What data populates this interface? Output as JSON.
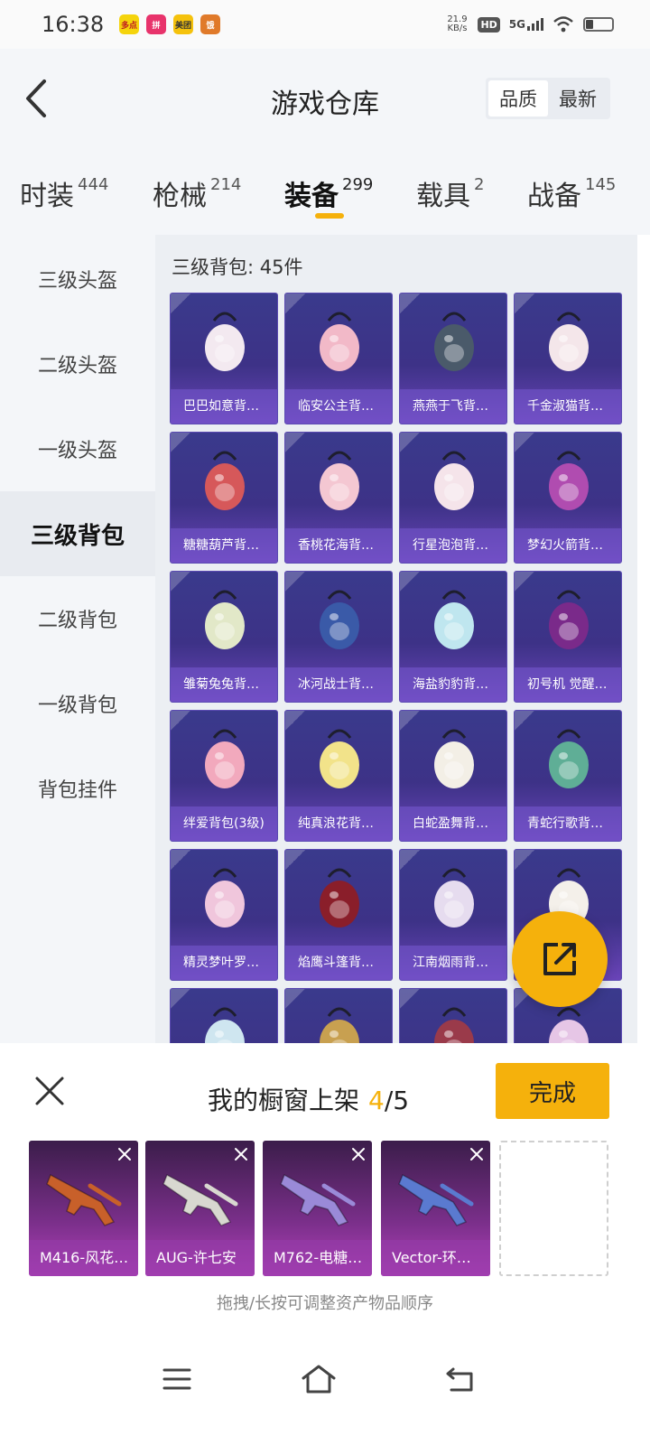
{
  "status_bar": {
    "time": "16:38",
    "notifications": [
      {
        "icon": "app-icon-1",
        "color": "#f5d40c",
        "text": "多点"
      },
      {
        "icon": "app-icon-2",
        "color": "#e8336b",
        "text": "拼"
      },
      {
        "icon": "app-icon-3",
        "color": "#f5c20c",
        "text": "美团"
      },
      {
        "icon": "app-icon-4",
        "color": "#e07a2a",
        "text": "饿"
      }
    ],
    "net_speed_value": "21.9",
    "net_speed_unit": "KB/s",
    "hd": "HD",
    "network": "5G"
  },
  "header": {
    "title": "游戏仓库",
    "sort_options": [
      {
        "label": "品质",
        "active": true
      },
      {
        "label": "最新",
        "active": false
      }
    ]
  },
  "tabs": [
    {
      "label": "时装",
      "count": "444",
      "active": false
    },
    {
      "label": "枪械",
      "count": "214",
      "active": false
    },
    {
      "label": "装备",
      "count": "299",
      "active": true
    },
    {
      "label": "载具",
      "count": "2",
      "active": false
    },
    {
      "label": "战备",
      "count": "145",
      "active": false
    }
  ],
  "sidebar": {
    "items": [
      {
        "label": "三级头盔",
        "active": false
      },
      {
        "label": "二级头盔",
        "active": false
      },
      {
        "label": "一级头盔",
        "active": false
      },
      {
        "label": "三级背包",
        "active": true
      },
      {
        "label": "二级背包",
        "active": false
      },
      {
        "label": "一级背包",
        "active": false
      },
      {
        "label": "背包挂件",
        "active": false
      }
    ]
  },
  "content": {
    "section_title": "三级背包: 45件",
    "items": [
      {
        "label": "巴巴如意背…",
        "color": "#f3e9f0"
      },
      {
        "label": "临安公主背…",
        "color": "#f2b9c8"
      },
      {
        "label": "燕燕于飞背…",
        "color": "#4a5a6a"
      },
      {
        "label": "千金淑猫背…",
        "color": "#f4e6ea"
      },
      {
        "label": "糖糖葫芦背…",
        "color": "#d6585a"
      },
      {
        "label": "香桃花海背…",
        "color": "#f4c7d2"
      },
      {
        "label": "行星泡泡背…",
        "color": "#f5e4ea"
      },
      {
        "label": "梦幻火箭背…",
        "color": "#b04cb0"
      },
      {
        "label": "雏菊兔兔背…",
        "color": "#e2e8c8"
      },
      {
        "label": "冰河战士背…",
        "color": "#3a5aa8"
      },
      {
        "label": "海盐豹豹背…",
        "color": "#bfe6ef"
      },
      {
        "label": "初号机 觉醒…",
        "color": "#7a2a8a"
      },
      {
        "label": "绊爱背包(3级)",
        "color": "#f2a9bd"
      },
      {
        "label": "纯真浪花背…",
        "color": "#f2e38a"
      },
      {
        "label": "白蛇盈舞背…",
        "color": "#f3efe6"
      },
      {
        "label": "青蛇行歌背…",
        "color": "#5fae96"
      },
      {
        "label": "精灵梦叶罗…",
        "color": "#f0c6dc"
      },
      {
        "label": "焰鹰斗篷背…",
        "color": "#8a1e2a"
      },
      {
        "label": "江南烟雨背…",
        "color": "#e6dcef"
      },
      {
        "label": "",
        "color": "#f4f0ea"
      },
      {
        "label": "",
        "color": "#cfe6f0"
      },
      {
        "label": "",
        "color": "#c8a050"
      },
      {
        "label": "",
        "color": "#9a3a4a"
      },
      {
        "label": "",
        "color": "#e6c6e6"
      }
    ]
  },
  "showcase": {
    "title": "我的橱窗上架",
    "count_used": "4",
    "count_sep": "/",
    "count_total": "5",
    "done_label": "完成",
    "slots": [
      {
        "label": "M416-风花…",
        "color": "#c8602a"
      },
      {
        "label": "AUG-许七安",
        "color": "#d8d8d0"
      },
      {
        "label": "M762-电糖…",
        "color": "#9a8ad8"
      },
      {
        "label": "Vector-环…",
        "color": "#5a7ad0"
      }
    ],
    "hint": "拖拽/长按可调整资产物品顺序"
  },
  "colors": {
    "accent": "#f5b10c",
    "card_purple": "#3d3287",
    "slot_magenta": "#b040b8"
  }
}
